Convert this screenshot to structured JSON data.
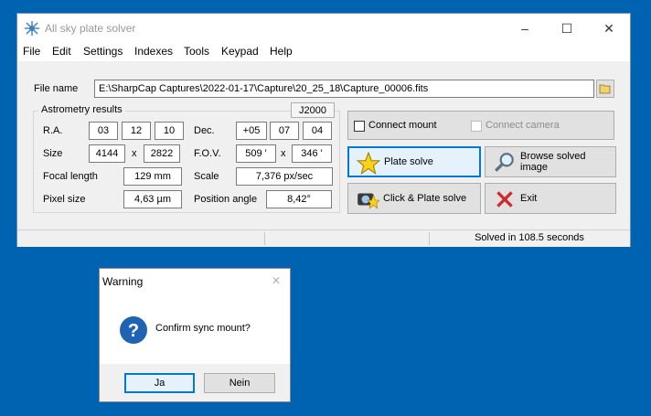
{
  "window": {
    "title": "All sky plate solver",
    "controls": {
      "minimize": "–",
      "maximize": "☐",
      "close": "✕"
    }
  },
  "menu": [
    "File",
    "Edit",
    "Settings",
    "Indexes",
    "Tools",
    "Keypad",
    "Help"
  ],
  "file": {
    "label": "File name",
    "value": "E:\\SharpCap Captures\\2022-01-17\\Capture\\20_25_18\\Capture_00006.fits"
  },
  "astrometry": {
    "group_title": "Astrometry results",
    "epoch_button": "J2000",
    "ra_label": "R.A.",
    "ra": [
      "03",
      "12",
      "10"
    ],
    "dec_label": "Dec.",
    "dec": [
      "+05",
      "07",
      "04"
    ],
    "size_label": "Size",
    "size_w": "4144",
    "size_x": "x",
    "size_h": "2822",
    "fov_label": "F.O.V.",
    "fov_w": "509 '",
    "fov_x": "x",
    "fov_h": "346 '",
    "focal_label": "Focal length",
    "focal_value": "129 mm",
    "scale_label": "Scale",
    "scale_value": "7,376  px/sec",
    "pixel_label": "Pixel size",
    "pixel_value": "4,63 µm",
    "angle_label": "Position angle",
    "angle_value": "8,42°"
  },
  "actions": {
    "connect_mount": "Connect mount",
    "connect_camera": "Connect camera",
    "plate_solve": "Plate solve",
    "browse": "Browse solved image",
    "click_plate": "Click & Plate solve",
    "exit": "Exit"
  },
  "status": {
    "solved": "Solved in 108.5 seconds"
  },
  "dialog": {
    "title": "Warning",
    "message": "Confirm sync mount?",
    "yes": "Ja",
    "no": "Nein"
  },
  "colors": {
    "desktop": "#0063b1",
    "accent": "#0078d7"
  }
}
